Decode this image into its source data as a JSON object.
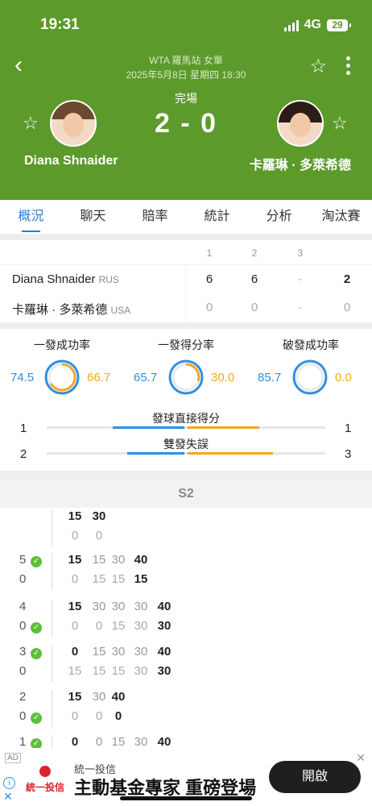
{
  "status_bar": {
    "time": "19:31",
    "network": "4G",
    "battery": "29"
  },
  "header": {
    "event": "WTA 羅馬站 女單",
    "datetime": "2025年5月8日 星期四 18:30",
    "match_status": "完場",
    "score": "2 - 0",
    "player1": {
      "name": "Diana Shnaider"
    },
    "player2": {
      "name": "卡羅琳 · 多萊希德"
    }
  },
  "tabs": [
    "概況",
    "聊天",
    "賠率",
    "統計",
    "分析",
    "淘汰賽"
  ],
  "set_table": {
    "headers": [
      "1",
      "2",
      "3"
    ],
    "rows": [
      {
        "name": "Diana Shnaider",
        "country": "RUS",
        "sets": [
          "6",
          "6",
          "-"
        ],
        "total": "2"
      },
      {
        "name": "卡羅琳 · 多萊希德",
        "country": "USA",
        "sets": [
          "0",
          "0",
          "-"
        ],
        "total": "0"
      }
    ]
  },
  "stats": {
    "rings": [
      {
        "label": "一發成功率",
        "left": "74.5",
        "right": "66.7"
      },
      {
        "label": "一發得分率",
        "left": "65.7",
        "right": "30.0"
      },
      {
        "label": "破發成功率",
        "left": "85.7",
        "right": "0.0"
      }
    ],
    "bars": [
      {
        "label": "發球直接得分",
        "left": "1",
        "right": "1"
      },
      {
        "label": "雙發失誤",
        "left": "2",
        "right": "3"
      }
    ]
  },
  "pbp": {
    "set_label": "S2",
    "games": [
      {
        "top_score": "",
        "top_points": [
          "15",
          "30"
        ],
        "bot_score": "",
        "bot_points": [
          "0",
          "0"
        ]
      },
      {
        "top_score": "5",
        "top_points": [
          "15",
          "15",
          "30",
          "40"
        ],
        "bot_score": "0",
        "bot_points": [
          "0",
          "15",
          "15",
          "15"
        ]
      },
      {
        "top_score": "4",
        "top_points": [
          "15",
          "30",
          "30",
          "30",
          "40"
        ],
        "bot_score": "0",
        "bot_points": [
          "0",
          "0",
          "15",
          "30",
          "30"
        ]
      },
      {
        "top_score": "3",
        "top_points": [
          "0",
          "15",
          "30",
          "30",
          "40"
        ],
        "bot_score": "0",
        "bot_points": [
          "15",
          "15",
          "15",
          "30",
          "30"
        ]
      },
      {
        "top_score": "2",
        "top_points": [
          "15",
          "30",
          "40"
        ],
        "bot_score": "0",
        "bot_points": [
          "0",
          "0",
          "0"
        ]
      },
      {
        "top_score": "1",
        "top_points": [
          "0",
          "0",
          "15",
          "30",
          "40"
        ],
        "bot_score": "",
        "bot_points": []
      }
    ]
  },
  "ad": {
    "tag": "AD",
    "logo_text": "統一投信",
    "brand": "統一投信",
    "headline": "主動基金專家 重磅登場",
    "cta": "開啟",
    "close": "✕"
  }
}
